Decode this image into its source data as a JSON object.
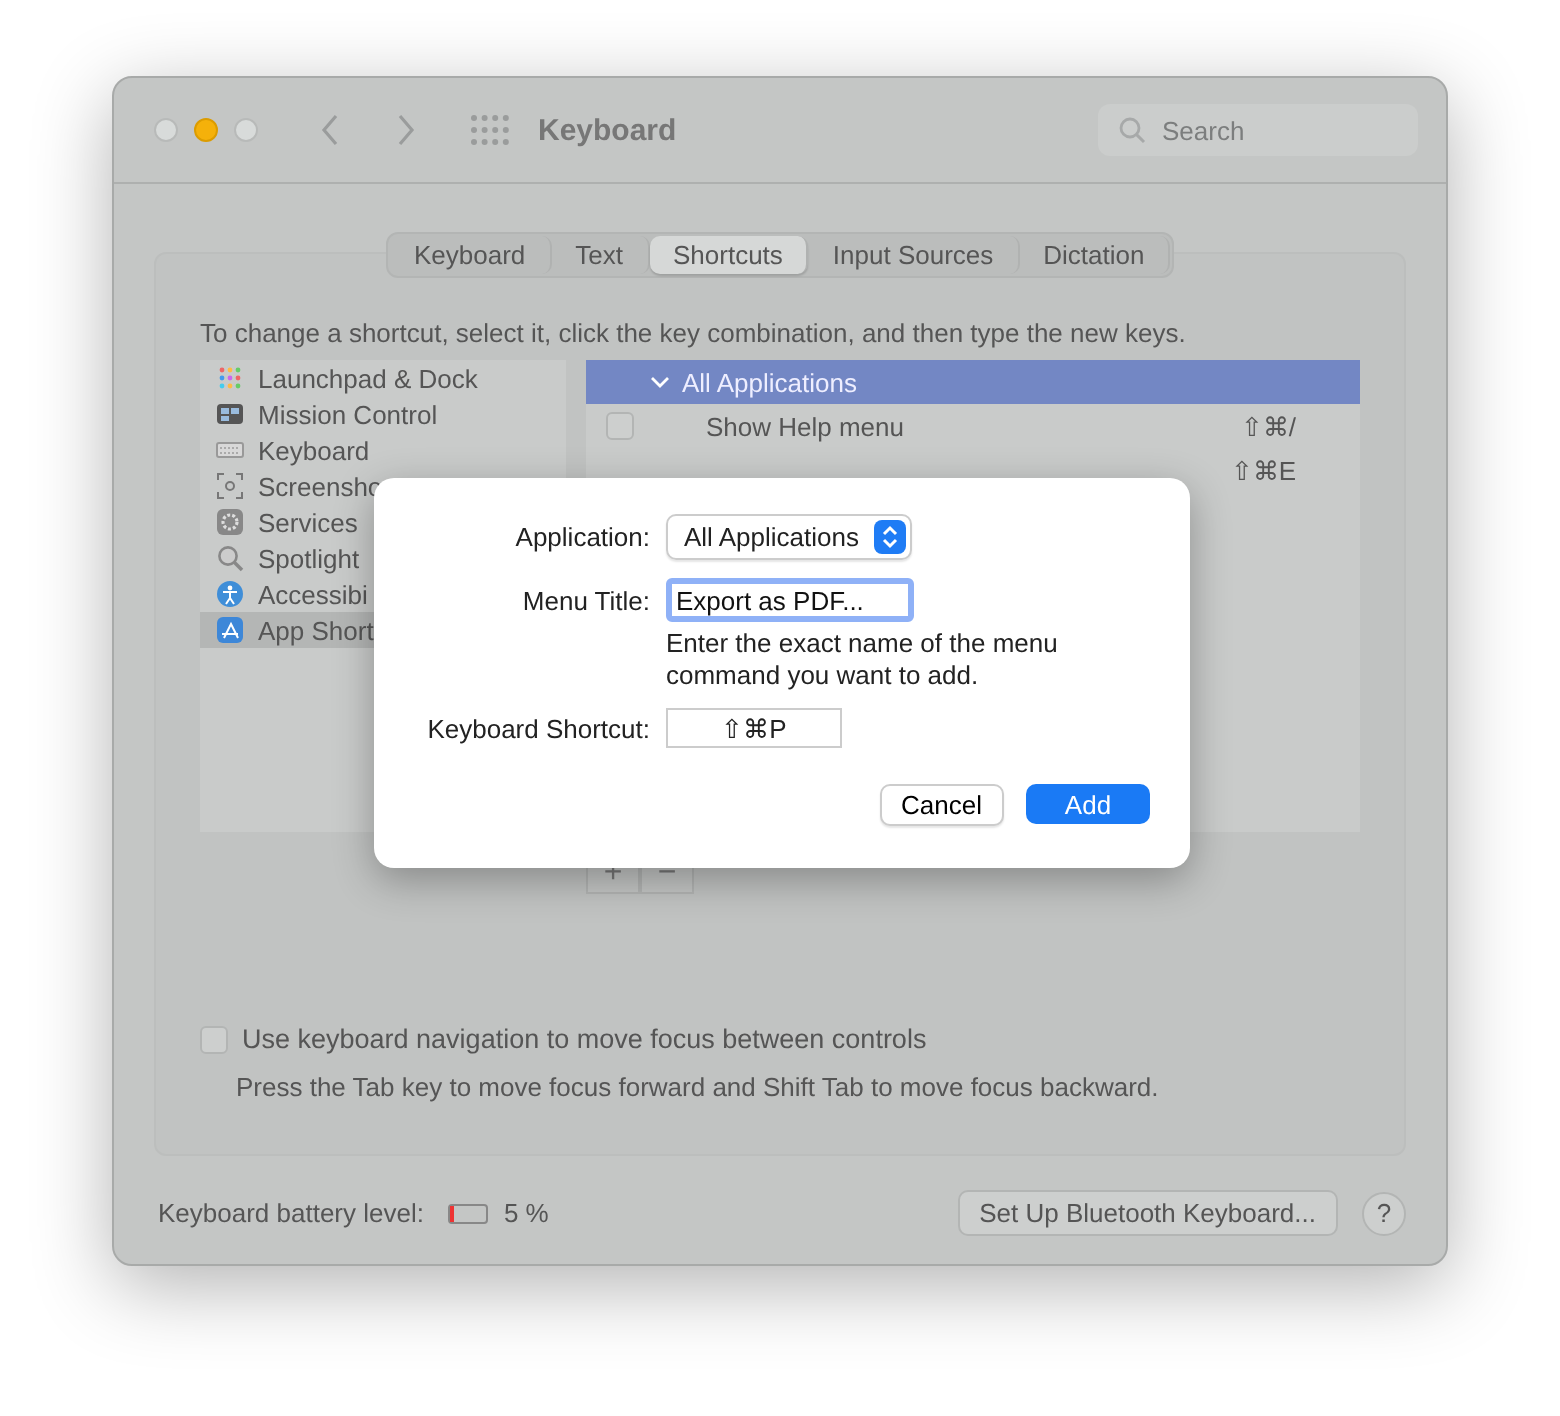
{
  "window": {
    "title": "Keyboard",
    "search": {
      "placeholder": "Search"
    }
  },
  "tabs": [
    {
      "label": "Keyboard",
      "selected": false
    },
    {
      "label": "Text",
      "selected": false
    },
    {
      "label": "Shortcuts",
      "selected": true
    },
    {
      "label": "Input Sources",
      "selected": false
    },
    {
      "label": "Dictation",
      "selected": false
    }
  ],
  "instruction": "To change a shortcut, select it, click the key combination, and then type the new keys.",
  "categories": [
    {
      "label": "Launchpad & Dock",
      "kind": "grid",
      "selected": false
    },
    {
      "label": "Mission Control",
      "kind": "mission",
      "selected": false
    },
    {
      "label": "Keyboard",
      "kind": "keyboard",
      "selected": false
    },
    {
      "label": "Screensho",
      "kind": "screenshot",
      "selected": false
    },
    {
      "label": "Services",
      "kind": "gear",
      "selected": false
    },
    {
      "label": "Spotlight",
      "kind": "search",
      "selected": false
    },
    {
      "label": "Accessibi",
      "kind": "person",
      "selected": false
    },
    {
      "label": "App Short",
      "kind": "app",
      "selected": true
    }
  ],
  "shortcuts": {
    "group": {
      "label": "All Applications",
      "expanded": true
    },
    "rows": [
      {
        "title": "Show Help menu",
        "checked": false,
        "keys": "⇧⌘/"
      },
      {
        "keys": "⇧⌘E"
      }
    ]
  },
  "list_buttons": [
    "+",
    "−"
  ],
  "keyboard_navigation": {
    "label": "Use keyboard navigation to move focus between controls",
    "checked": false,
    "hint": "Press the Tab key to move focus forward and Shift Tab to move focus backward."
  },
  "battery": {
    "label": "Keyboard battery level:",
    "level": 0.05,
    "reading": "5 %"
  },
  "bluetooth_button": "Set Up Bluetooth Keyboard...",
  "help_button": "?",
  "dialog": {
    "application_label": "Application:",
    "application": "All Applications",
    "menu_title_label": "Menu Title:",
    "menu_title": "Export as PDF...",
    "menu_title_hint": "Enter the exact name of the menu command you want to add.",
    "shortcut_label": "Keyboard Shortcut:",
    "shortcut": "⇧⌘P",
    "cancel": "Cancel",
    "add": "Add"
  }
}
